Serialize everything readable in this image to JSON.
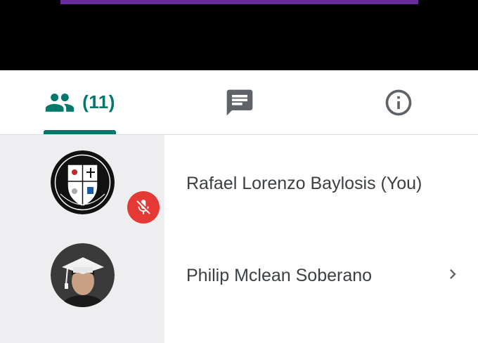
{
  "tabs": {
    "people_count": "(11)",
    "active": "people"
  },
  "participants": [
    {
      "name": "Rafael Lorenzo Baylosis (You)",
      "avatar": "school-crest-avatar",
      "muted": true
    },
    {
      "name": "Philip Mclean Soberano",
      "avatar": "graduation-photo-avatar",
      "muted": false
    }
  ],
  "colors": {
    "accent": "#00796b",
    "mute": "#e53935",
    "avatar_bg": "#eeeef1",
    "video_strip": "#6a2c9a"
  }
}
